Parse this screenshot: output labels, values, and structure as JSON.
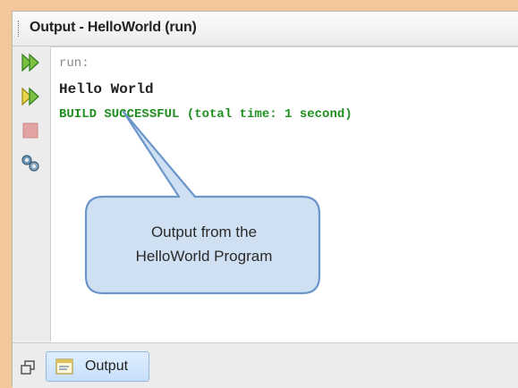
{
  "window": {
    "title": "Output - HelloWorld (run)"
  },
  "toolbar": {
    "items": [
      {
        "icon": "rerun-icon"
      },
      {
        "icon": "rerun-with-options-icon"
      },
      {
        "icon": "stop-icon"
      },
      {
        "icon": "settings-icon"
      }
    ]
  },
  "console": {
    "lines": [
      "run:",
      "Hello World",
      "BUILD SUCCESSFUL (total time: 1 second)"
    ]
  },
  "callout": {
    "line1": "Output from the",
    "line2": "HelloWorld Program"
  },
  "bottom": {
    "tab_label": "Output"
  },
  "colors": {
    "background": "#f2c79c",
    "callout_fill": "#cfe0f3",
    "callout_border": "#6b96c9",
    "success_text": "#1f8f1f"
  }
}
